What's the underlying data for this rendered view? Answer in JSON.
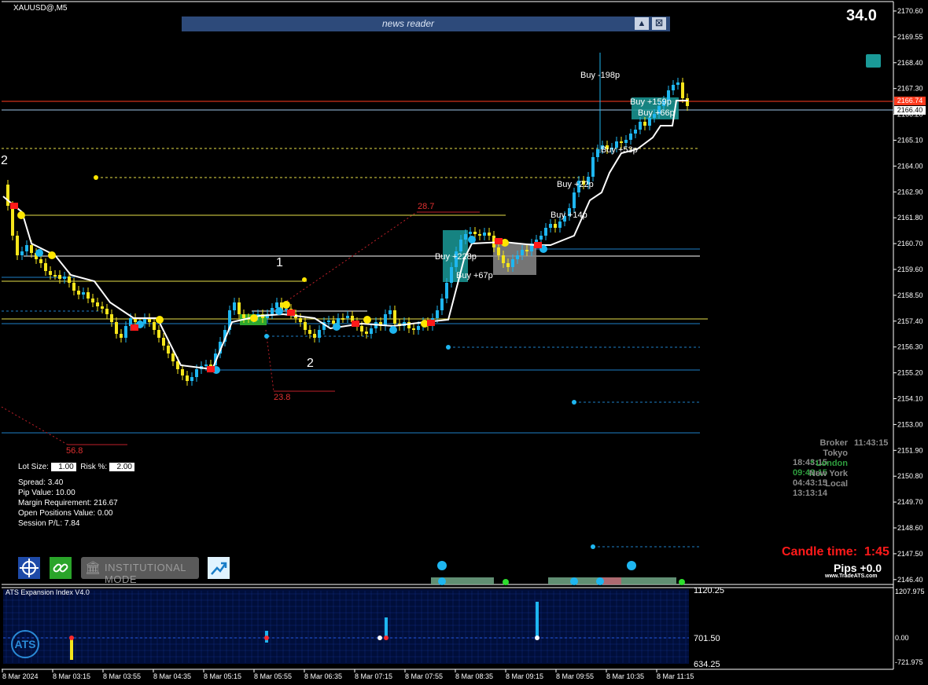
{
  "symbol": "XAUUSD@,M5",
  "corner_value": "34.0",
  "news_reader": {
    "title": "news reader",
    "up_icon": "triangle-up-icon",
    "close_icon": "close-box-icon"
  },
  "price_axis": {
    "ticks": [
      "2170.60",
      "2169.55",
      "2168.40",
      "2167.30",
      "2166.20",
      "2165.10",
      "2164.00",
      "2162.90",
      "2161.80",
      "2160.70",
      "2159.60",
      "2158.50",
      "2157.40",
      "2156.30",
      "2155.20",
      "2154.10",
      "2153.00",
      "2151.90",
      "2150.80",
      "2149.70",
      "2148.60",
      "2147.50",
      "2146.40"
    ],
    "current_red": "2166.74",
    "current_white": "2166.40"
  },
  "time_axis": [
    "8 Mar 2024",
    "8 Mar 03:15",
    "8 Mar 03:55",
    "8 Mar 04:35",
    "8 Mar 05:15",
    "8 Mar 05:55",
    "8 Mar 06:35",
    "8 Mar 07:15",
    "8 Mar 07:55",
    "8 Mar 08:35",
    "8 Mar 09:15",
    "8 Mar 09:55",
    "8 Mar 10:35",
    "8 Mar 11:15"
  ],
  "annotations": {
    "wave_left": "2",
    "wave_1": "1",
    "wave_2": "2",
    "fib_top": "28.7",
    "fib_mid": "23.8",
    "fib_low": "56.8"
  },
  "trade_labels": [
    "Buy -198p",
    "Buy +159p",
    "Buy +66p",
    "Buy +53p",
    "Buy +22p",
    "Buy +14p",
    "Buy +228p",
    "Buy +67p"
  ],
  "trade_panel": {
    "lot_label": "Lot Size:",
    "lot_value": "1.00",
    "risk_label": "Risk %:",
    "risk_value": "2.00",
    "spread": "Spread: 3.40",
    "pip_value": "Pip Value: 10.00",
    "margin": "Margin Requirement: 216.67",
    "open_positions": "Open Positions Value: 0.00",
    "session_pl": "Session P/L: 7.84"
  },
  "toolbar": {
    "target_icon": "crosshair-target-icon",
    "link_icon": "chain-link-icon",
    "institutional_label": "INSTITUTIONAL MODE",
    "institution_icon": "bank-building-icon",
    "chart_icon": "chart-arrow-icon"
  },
  "clocks": [
    {
      "name": "Broker",
      "time": "11:43:15",
      "color": "#8a8a8a"
    },
    {
      "name": "Tokyo",
      "time": "18:43:15",
      "color": "#8a8a8a"
    },
    {
      "name": "* London",
      "time": "09:43:15",
      "color": "#2e9e3e"
    },
    {
      "name": "New York",
      "time": "04:43:15",
      "color": "#8a8a8a"
    },
    {
      "name": "Local",
      "time": "13:13:14",
      "color": "#8a8a8a"
    }
  ],
  "candle_time": {
    "label": "Candle time:",
    "value": "1:45"
  },
  "pips": "Pips +0.0",
  "brand": "www.TradeATS.com",
  "indicator": {
    "title": "ATS Expansion Index V4.0",
    "level_top": "1120.25",
    "level_mid": "701.50",
    "level_bottom": "634.25",
    "axis_top": "1207.975",
    "axis_mid": "0.00",
    "axis_bottom": "-721.975",
    "logo": "ATS"
  },
  "colors": {
    "bull": "#1eb6f0",
    "bear": "#f5e51b",
    "trail": "#ffffff",
    "red_line": "#ff3b1f",
    "blue_line": "#1e7fc8",
    "yellow_line": "#e8e04a",
    "teal": "#1a9a98"
  }
}
